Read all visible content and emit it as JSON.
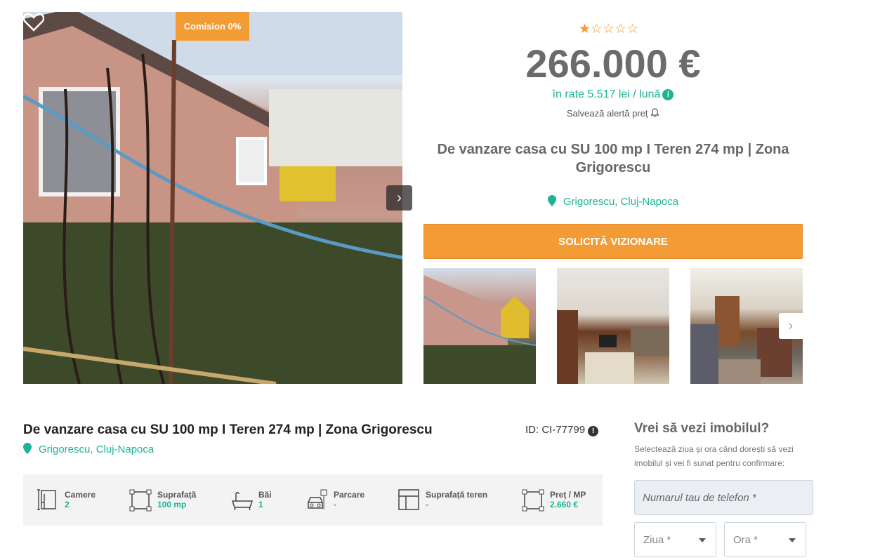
{
  "badge": {
    "comision": "Comision 0%"
  },
  "rating": {
    "stars_filled": 1,
    "stars_total": 5
  },
  "price": {
    "value": "266.000 €",
    "rate": "în rate 5.517 lei / lună",
    "alert": "Salvează alertă preț"
  },
  "listing": {
    "title": "De vanzare casa cu SU 100 mp I Teren 274 mp | Zona Grigorescu",
    "location": "Grigorescu, Cluj-Napoca",
    "id": "ID: CI-77799"
  },
  "cta": {
    "label": "SOLICITĂ VIZIONARE"
  },
  "features": [
    {
      "label": "Camere",
      "value": "2",
      "icon": "rooms-icon"
    },
    {
      "label": "Suprafață",
      "value": "100 mp",
      "icon": "area-icon"
    },
    {
      "label": "Băi",
      "value": "1",
      "icon": "bathtub-icon"
    },
    {
      "label": "Parcare",
      "value": "-",
      "icon": "parking-icon"
    },
    {
      "label": "Suprafață teren",
      "value": "-",
      "icon": "land-icon"
    },
    {
      "label": "Preț / MP",
      "value": "2.660 €",
      "icon": "price-per-sqm-icon"
    }
  ],
  "form": {
    "title": "Vrei să vezi imobilul?",
    "description": "Selectează ziua și ora când dorești să vezi imobilul și vei fi sunat pentru confirmare:",
    "phone_placeholder": "Numarul tau de telefon *",
    "day_placeholder": "Ziua *",
    "hour_placeholder": "Ora *"
  },
  "colors": {
    "accent": "#f39b35",
    "teal": "#1db393"
  }
}
